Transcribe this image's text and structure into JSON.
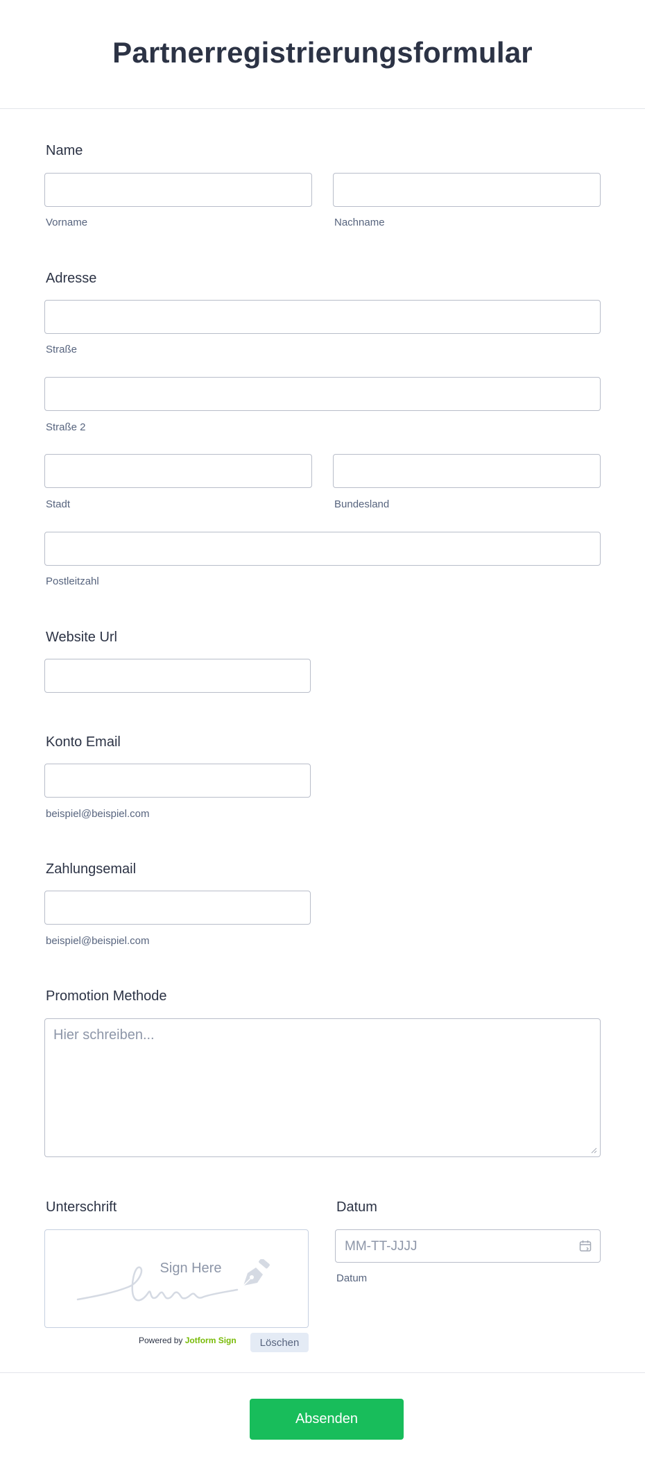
{
  "form": {
    "title": "Partnerregistrierungsformular"
  },
  "name": {
    "label": "Name",
    "first_sublabel": "Vorname",
    "last_sublabel": "Nachname"
  },
  "address": {
    "label": "Adresse",
    "street_sublabel": "Straße",
    "street2_sublabel": "Straße 2",
    "city_sublabel": "Stadt",
    "state_sublabel": "Bundesland",
    "zip_sublabel": "Postleitzahl"
  },
  "website": {
    "label": "Website Url"
  },
  "account_email": {
    "label": "Konto Email",
    "sublabel": "beispiel@beispiel.com"
  },
  "payment_email": {
    "label": "Zahlungsemail",
    "sublabel": "beispiel@beispiel.com"
  },
  "promotion": {
    "label": "Promotion Methode",
    "placeholder": "Hier schreiben..."
  },
  "signature": {
    "label": "Unterschrift",
    "sign_here": "Sign Here",
    "powered_by": "Powered by",
    "brand": "Jotform Sign",
    "clear_label": "Löschen"
  },
  "date": {
    "label": "Datum",
    "placeholder": "MM-TT-JJJJ",
    "sublabel": "Datum"
  },
  "submit": {
    "label": "Absenden",
    "color": "#18bd5b"
  },
  "icons": {
    "calendar": "calendar-icon",
    "pen": "pen-nib-icon"
  }
}
